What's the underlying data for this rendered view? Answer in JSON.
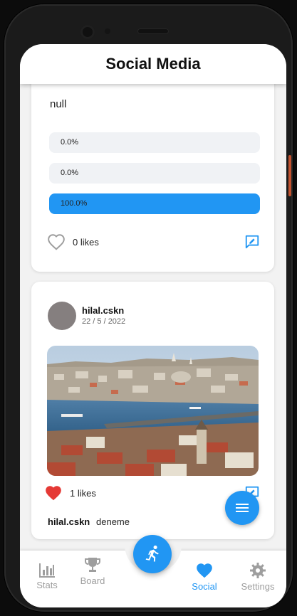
{
  "app": {
    "title": "Social Media"
  },
  "poll_card": {
    "text": "null",
    "options": [
      {
        "label": "0.0%",
        "fraction": 0.0
      },
      {
        "label": "0.0%",
        "fraction": 0.0
      },
      {
        "label": "100.0%",
        "fraction": 1.0
      }
    ],
    "likes": "0 likes"
  },
  "post_card": {
    "username": "hilal.cskn",
    "date": "22 / 5 / 2022",
    "likes": "1 likes",
    "caption_user": "hilal.cskn",
    "caption_text": "deneme"
  },
  "bottom_nav": {
    "items": [
      {
        "label": "Stats",
        "icon": "bar-chart-icon"
      },
      {
        "label": "Board",
        "icon": "trophy-icon"
      },
      {
        "label": "Social",
        "icon": "heart-icon",
        "active": true
      },
      {
        "label": "Settings",
        "icon": "gear-icon"
      }
    ]
  },
  "colors": {
    "accent": "#2196f3",
    "like": "#e53935",
    "inactive": "#9e9e9e"
  }
}
